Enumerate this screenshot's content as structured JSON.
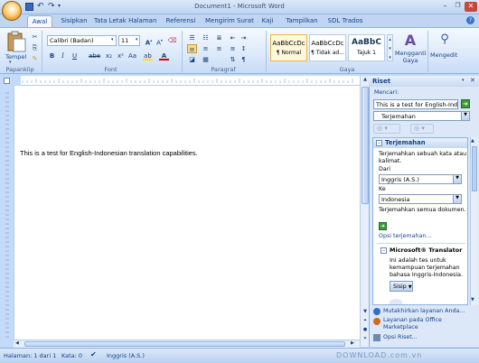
{
  "window": {
    "title": "Document1 - Microsoft Word"
  },
  "tabs": [
    "Awal",
    "Sisipkan",
    "Tata Letak Halaman",
    "Referensi",
    "Mengirim Surat",
    "Kaji",
    "Tampilkan",
    "SDL Trados"
  ],
  "ribbon": {
    "clipboard": {
      "paste_label": "Tempel",
      "group_label": "Papanklip"
    },
    "font": {
      "font_name": "Calibri (Badan)",
      "font_size": "11",
      "group_label": "Font"
    },
    "paragraph": {
      "group_label": "Paragraf"
    },
    "styles": {
      "items": [
        {
          "preview": "AaBbCcDc",
          "name": "¶ Normal"
        },
        {
          "preview": "AaBbCcDc",
          "name": "¶ Tidak ad..."
        },
        {
          "preview": "AaBbC",
          "name": "Tajuk 1"
        }
      ],
      "change_styles": "Mengganti Gaya",
      "group_label": "Gaya"
    },
    "editing": {
      "label": "Mengedit"
    }
  },
  "document": {
    "text": "This is a test for English-Indonesian translation capabilities."
  },
  "research": {
    "title": "Riset",
    "search_label": "Mencari:",
    "search_value": "This is a test for English-Indone",
    "service": "Terjemahan",
    "section_title": "Terjemahan",
    "section_desc": "Terjemahkan sebuah kata atau kalimat.",
    "from_label": "Dari",
    "from_value": "Inggris (A.S.)",
    "to_label": "Ke",
    "to_value": "Indonesia",
    "translate_doc": "Terjemahkan semua dokumen.",
    "options_link": "Opsi terjemahan...",
    "translator_title": "Microsoft® Translator",
    "translator_result": "Ini adalah tes untuk kemampuan terjemahan bahasa Inggris-Indonesia.",
    "insert_label": "Sisip",
    "links": [
      "Mutakhirkan layanan Anda...",
      "Layanan pada Office Marketplace",
      "Opsi Riset..."
    ]
  },
  "status": {
    "page": "Halaman: 1 dari 1",
    "words": "Kata: 0",
    "language": "Inggris (A.S.)",
    "watermark": "DOWNLOAD.com.vn"
  },
  "colors": {
    "ribbon": "#dce9fa",
    "accent": "#15428b"
  }
}
